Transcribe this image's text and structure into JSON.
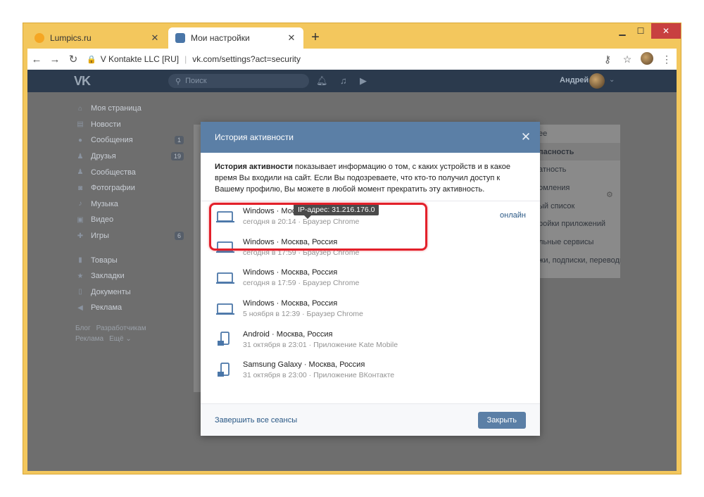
{
  "browser": {
    "tabs": [
      {
        "title": "Lumpics.ru",
        "close": "✕"
      },
      {
        "title": "Мои настройки",
        "close": "✕"
      }
    ],
    "new_tab": "+",
    "address": {
      "site_identity": "V Kontakte LLC [RU]",
      "url": "vk.com/settings?act=security"
    }
  },
  "vk_header": {
    "logo": "VK",
    "search_placeholder": "Поиск",
    "user_name": "Андрей"
  },
  "left_nav": {
    "items": [
      {
        "label": "Моя страница",
        "badge": ""
      },
      {
        "label": "Новости",
        "badge": ""
      },
      {
        "label": "Сообщения",
        "badge": "1"
      },
      {
        "label": "Друзья",
        "badge": "19"
      },
      {
        "label": "Сообщества",
        "badge": ""
      },
      {
        "label": "Фотографии",
        "badge": ""
      },
      {
        "label": "Музыка",
        "badge": ""
      },
      {
        "label": "Видео",
        "badge": ""
      },
      {
        "label": "Игры",
        "badge": "6"
      }
    ],
    "items2": [
      {
        "label": "Товары"
      },
      {
        "label": "Закладки"
      },
      {
        "label": "Документы"
      },
      {
        "label": "Реклама"
      }
    ],
    "footer": [
      "Блог",
      "Разработчикам",
      "Реклама",
      "Ещё ⌄"
    ]
  },
  "settings_menu": {
    "items": [
      "ее",
      "пасность",
      "атность",
      "омления",
      "ый список",
      "ройки приложений",
      "льные сервисы",
      "жи, подписки, переводы"
    ],
    "selected_index": 1
  },
  "modal": {
    "title": "История активности",
    "close": "✕",
    "description_bold": "История активности",
    "description_rest": " показывает информацию о том, с каких устройств и в какое время Вы входили на сайт. Если Вы подозреваете, что кто-то получил доступ к Вашему профилю, Вы можете в любой момент прекратить эту активность.",
    "ip_tooltip": "IP-адрес: 31.216.176.0",
    "sessions": [
      {
        "device": "Windows",
        "location": "Москва, Россия",
        "time": "сегодня в 20:14",
        "client": "Браузер Chrome",
        "status": "онлайн",
        "icon": "laptop-icon"
      },
      {
        "device": "Windows",
        "location": "Москва, Россия",
        "time": "сегодня в 17:59",
        "client": "Браузер Chrome",
        "status": "",
        "icon": "laptop-icon"
      },
      {
        "device": "Windows",
        "location": "Москва, Россия",
        "time": "сегодня в 17:59",
        "client": "Браузер Chrome",
        "status": "",
        "icon": "laptop-icon"
      },
      {
        "device": "Windows",
        "location": "Москва, Россия",
        "time": "5 ноября в 12:39",
        "client": "Браузер Chrome",
        "status": "",
        "icon": "laptop-icon"
      },
      {
        "device": "Android",
        "location": "Москва, Россия",
        "time": "31 октября в 23:01",
        "client": "Приложение Kate Mobile",
        "status": "",
        "icon": "android-phone-icon"
      },
      {
        "device": "Samsung Galaxy",
        "location": "Москва, Россия",
        "time": "31 октября в 23:00",
        "client": "Приложение ВКонтакте",
        "status": "",
        "icon": "android-phone-icon"
      }
    ],
    "end_all_sessions": "Завершить все сеансы",
    "close_button": "Закрыть"
  },
  "colors": {
    "window_frame": "#f3c75d",
    "vk_header": "#2b3a4d",
    "modal_header": "#5b7fa6",
    "link": "#2a5885",
    "highlight": "#e3202a"
  }
}
